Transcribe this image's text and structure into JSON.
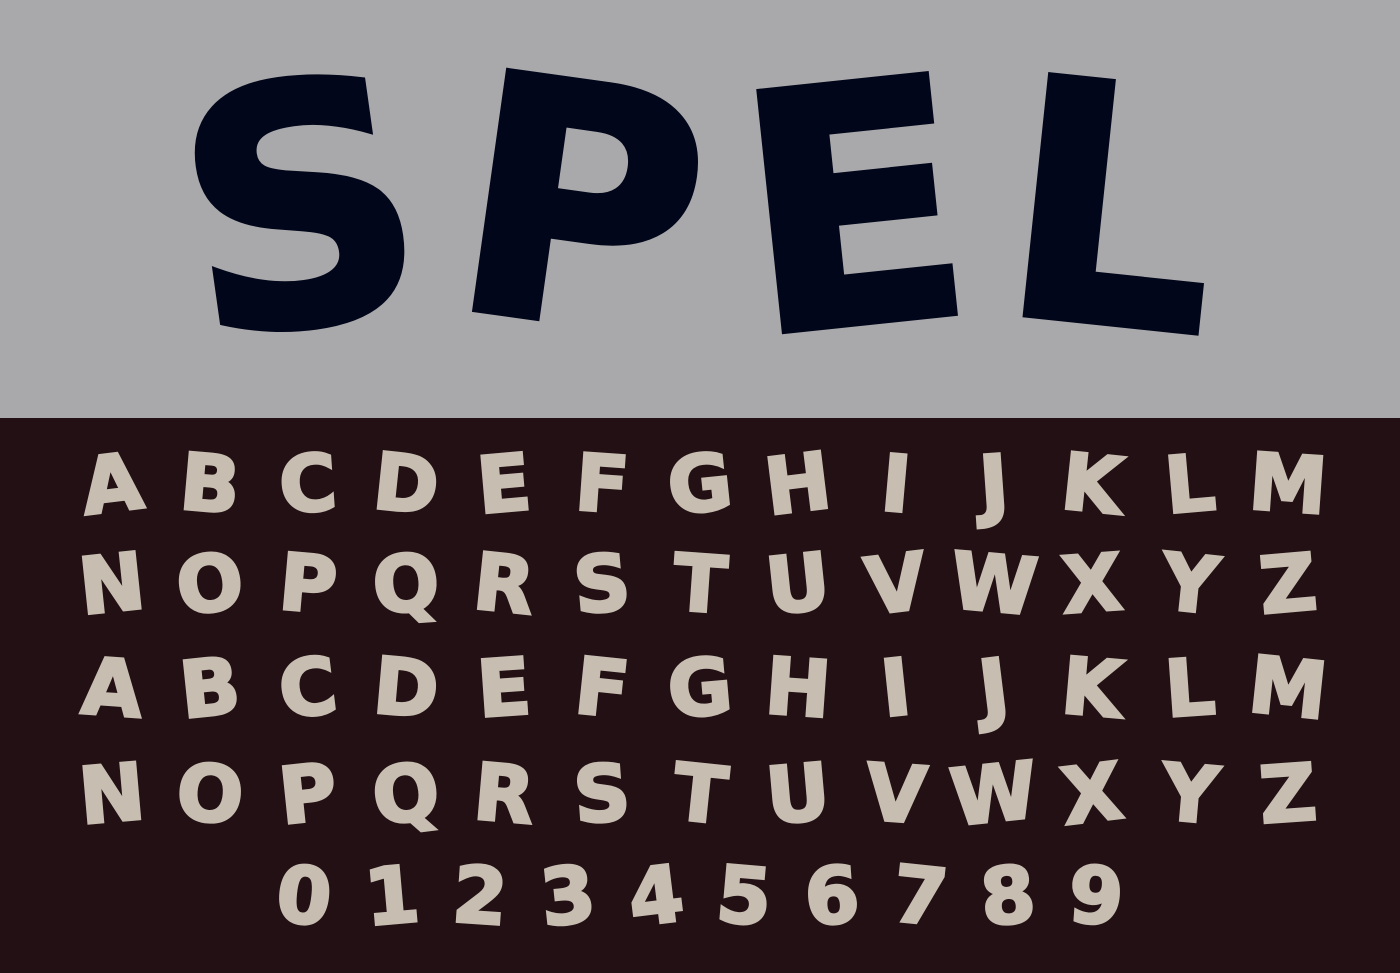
{
  "colors": {
    "top_background": "#a9a9ab",
    "bottom_background": "#231014",
    "title_color": "#02061a",
    "glyph_color": "#c7beb1"
  },
  "title": {
    "letters": [
      "S",
      "P",
      "E",
      "L"
    ]
  },
  "rows": [
    {
      "glyphs": [
        "A",
        "B",
        "C",
        "D",
        "E",
        "F",
        "G",
        "H",
        "I",
        "J",
        "K",
        "L",
        "M"
      ]
    },
    {
      "glyphs": [
        "N",
        "O",
        "P",
        "Q",
        "R",
        "S",
        "T",
        "U",
        "V",
        "W",
        "X",
        "Y",
        "Z"
      ]
    },
    {
      "glyphs": [
        "A",
        "B",
        "C",
        "D",
        "E",
        "F",
        "G",
        "H",
        "I",
        "J",
        "K",
        "L",
        "M"
      ]
    },
    {
      "glyphs": [
        "N",
        "O",
        "P",
        "Q",
        "R",
        "S",
        "T",
        "U",
        "V",
        "W",
        "X",
        "Y",
        "Z"
      ]
    },
    {
      "glyphs": [
        "0",
        "1",
        "2",
        "3",
        "4",
        "5",
        "6",
        "7",
        "8",
        "9"
      ]
    }
  ]
}
